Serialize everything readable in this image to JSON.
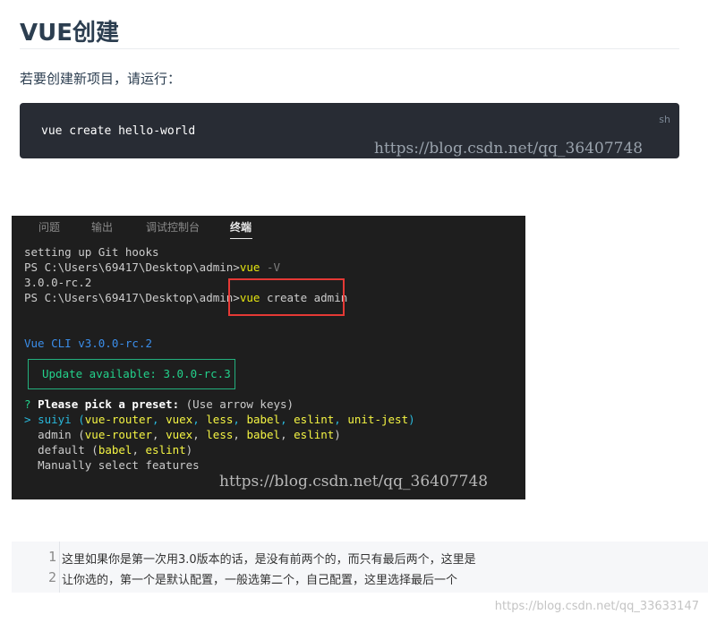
{
  "heading": "VUE创建",
  "intro": "若要创建新项目，请运行：",
  "code_block": {
    "lang": "sh",
    "code": "vue create hello-world"
  },
  "watermark_top": "https://blog.csdn.net/qq_36407748",
  "terminal": {
    "tabs": [
      "问题",
      "输出",
      "调试控制台",
      "终端"
    ],
    "active_tab": "终端",
    "line1": "setting up Git hooks",
    "prompt": "PS C:\\Users\\69417\\Desktop\\admin>",
    "cmd1_name": "vue",
    "cmd1_arg": "-V",
    "version": "3.0.0-rc.2",
    "cmd2_name": "vue",
    "cmd2_arg": "create admin",
    "cli_line": "Vue CLI v3.0.0-rc.2",
    "update_text": "Update available: 3.0.0-rc.3",
    "q_mark": "?",
    "q_text": "Please pick a preset:",
    "q_hint": "(Use arrow keys)",
    "pointer": ">",
    "preset1_name": "suiyi",
    "preset1_features": [
      "vue-router",
      "vuex",
      "less",
      "babel",
      "eslint",
      "unit-jest"
    ],
    "preset2_name": "admin",
    "preset2_features": [
      "vue-router",
      "vuex",
      "less",
      "babel",
      "eslint"
    ],
    "preset3_name": "default",
    "preset3_features": [
      "babel",
      "eslint"
    ],
    "preset4_name": "Manually select features",
    "watermark": "https://blog.csdn.net/qq_36407748"
  },
  "note": {
    "line_numbers": [
      "1",
      "2"
    ],
    "lines": [
      "这里如果你是第一次用3.0版本的话，是没有前两个的，而只有最后两个，这里是",
      "让你选的，第一个是默认配置，一般选第二个，自己配置，这里选择最后一个"
    ]
  },
  "watermark_bottom": "https://blog.csdn.net/qq_33633147"
}
